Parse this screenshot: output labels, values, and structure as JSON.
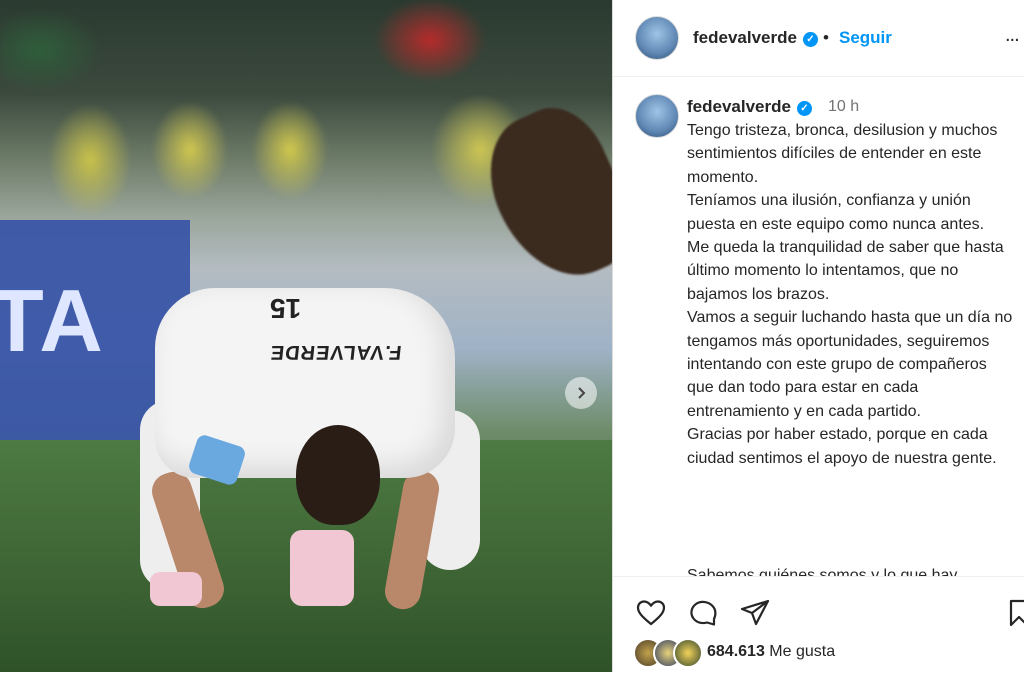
{
  "post": {
    "image_alt": "",
    "jersey_name": "F.VALVERDE",
    "jersey_number": "15",
    "board_text": "TA"
  },
  "header": {
    "username": "fedevalverde",
    "separator": "•",
    "follow_label": "Seguir",
    "more_label": "..."
  },
  "caption": {
    "username": "fedevalverde",
    "time": "10 h",
    "lines": [
      "Tengo tristeza, bronca, desilusion y muchos sentimientos difíciles de entender en este momento.",
      "Teníamos una ilusión, confianza y unión puesta en este equipo como nunca antes.",
      "Me queda la tranquilidad de saber que hasta último momento lo intentamos, que no bajamos los brazos.",
      "Vamos a seguir luchando hasta que un día no tengamos más oportunidades, seguiremos intentando con este grupo de compañeros que dan todo para estar en cada entrenamiento y en cada partido.",
      "Gracias por haber estado, porque en cada ciudad sentimos el apoyo de nuestra gente."
    ],
    "cut_line": "Sabemos quiénes somos y lo que hay"
  },
  "actions": {
    "like_icon": "heart-icon",
    "comment_icon": "comment-icon",
    "share_icon": "share-icon",
    "save_icon": "bookmark-icon"
  },
  "likes": {
    "count": "684.613",
    "label": "Me gusta"
  },
  "colors": {
    "accent": "#0095f6",
    "text": "#262626",
    "muted": "#737373"
  }
}
